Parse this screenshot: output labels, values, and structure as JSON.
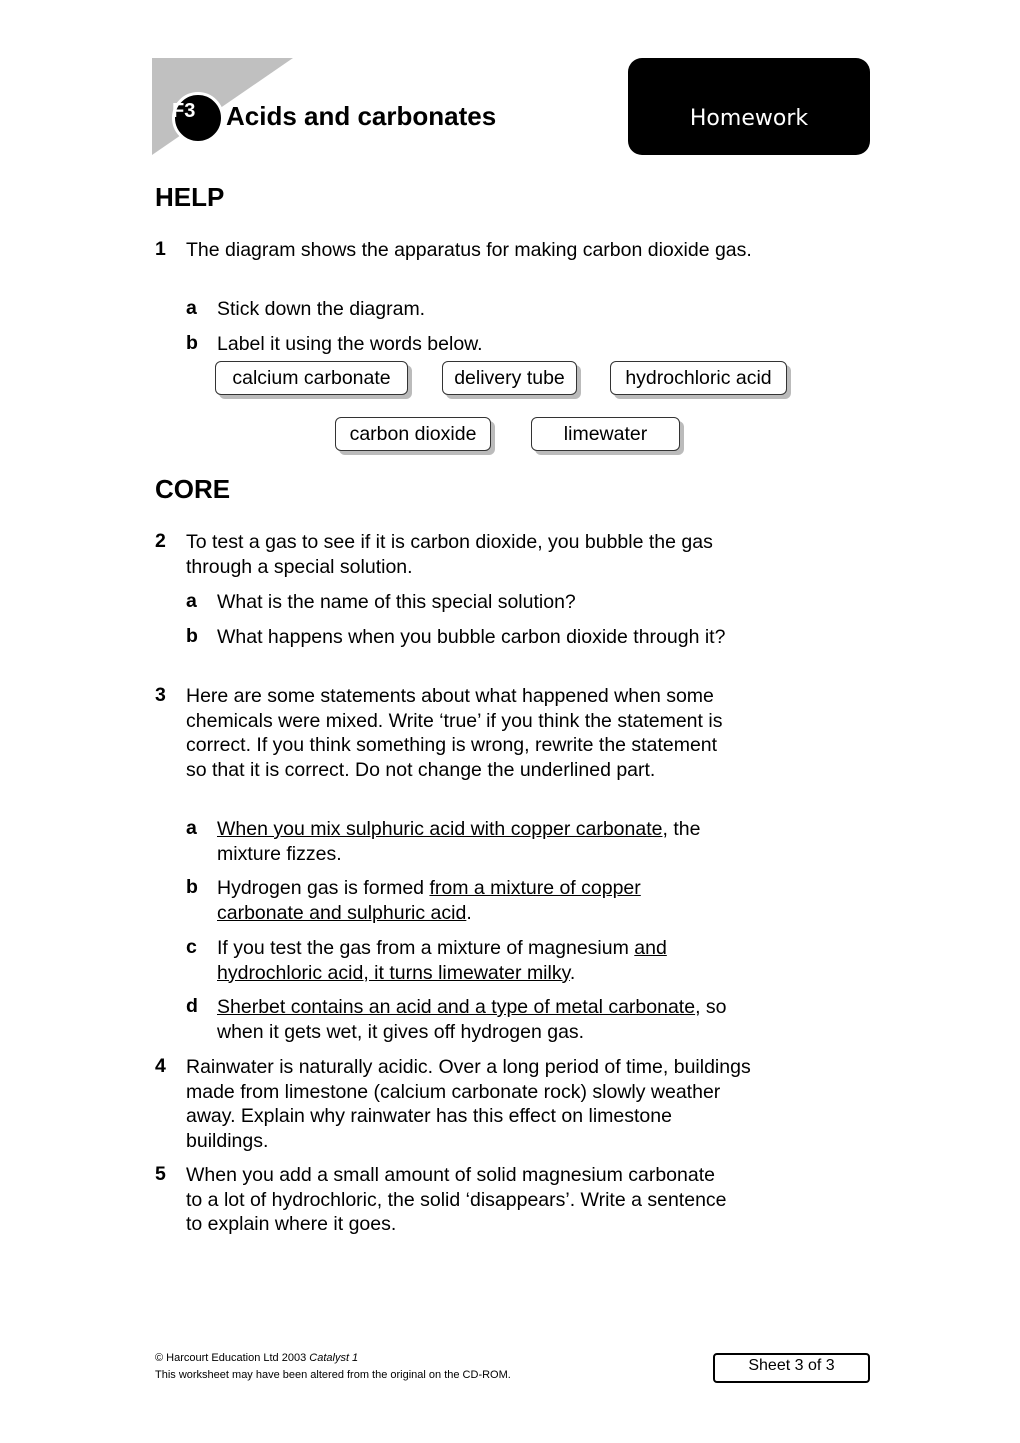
{
  "header": {
    "unit_code": "F3",
    "title": "Acids and carbonates",
    "badge_label": "Homework"
  },
  "sections": {
    "help": "HELP",
    "core": "CORE"
  },
  "q1": {
    "num": "1",
    "text": "The diagram shows the apparatus for making carbon dioxide gas.",
    "a": {
      "letter": "a",
      "text": "Stick down the diagram."
    },
    "b": {
      "letter": "b",
      "text": "Label it using the words below."
    },
    "words": [
      "calcium carbonate",
      "delivery tube",
      "hydrochloric acid",
      "carbon dioxide",
      "limewater"
    ]
  },
  "q2": {
    "num": "2",
    "text": "To test a gas to see if it is carbon dioxide, you bubble the gas through a special solution.",
    "a": {
      "letter": "a",
      "text": "What is the name of this special solution?"
    },
    "b": {
      "letter": "b",
      "text": "What happens when you bubble carbon dioxide through it?"
    }
  },
  "q3": {
    "num": "3",
    "text": "Here are some statements about what happened when some chemicals were mixed. Write ‘true’ if you think the statement is correct. If you think something is wrong, rewrite the statement so that it is correct. Do not change the underlined part.",
    "a": {
      "letter": "a",
      "u": "When you mix sulphuric acid with copper carbonate",
      "rest": ", the mixture fizzes."
    },
    "b": {
      "letter": "b",
      "pre": "Hydrogen gas is formed ",
      "u": "from a mixture of copper carbonate and sulphuric acid",
      "rest": "."
    },
    "c": {
      "letter": "c",
      "pre": "If you test the gas from a mixture of magnesium ",
      "u": "and hydrochloric acid, it turns limewater milky",
      "rest": "."
    },
    "d": {
      "letter": "d",
      "u": "Sherbet contains an acid and a type of metal carbonate",
      "rest": ", so when it gets wet, it gives off hydrogen gas."
    }
  },
  "q4": {
    "num": "4",
    "text": "Rainwater is naturally acidic. Over a long period of time, buildings made from limestone (calcium carbonate rock) slowly weather away. Explain why rainwater has this effect on limestone buildings."
  },
  "q5": {
    "num": "5",
    "text": "When you add a small amount of solid magnesium carbonate to a lot of hydrochloric, the solid ‘disappears’. Write a sentence to explain where it goes."
  },
  "footer": {
    "copyright": "© Harcourt Education Ltd 2003 ",
    "book": "Catalyst 1",
    "note": "This worksheet may have been altered from the original on the CD-ROM.",
    "sheet": "Sheet 3 of 3"
  }
}
